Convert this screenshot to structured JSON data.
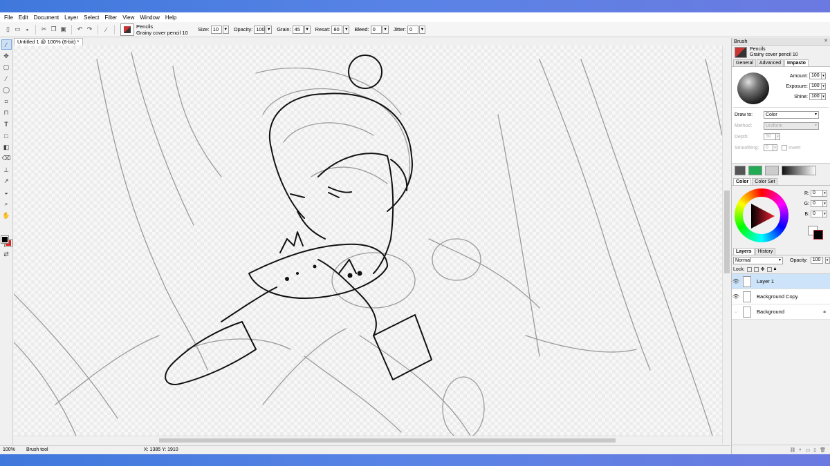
{
  "menu": [
    "File",
    "Edit",
    "Document",
    "Layer",
    "Select",
    "Filter",
    "View",
    "Window",
    "Help"
  ],
  "toolbar": {
    "brush_category": "Pencils",
    "brush_name": "Grainy cover pencil 10",
    "size_label": "Size:",
    "size_value": "10",
    "opacity_label": "Opacity:",
    "opacity_value": "100",
    "grain_label": "Grain:",
    "grain_value": "45",
    "resat_label": "Resat:",
    "resat_value": "80",
    "bleed_label": "Bleed:",
    "bleed_value": "0",
    "jitter_label": "Jitter:",
    "jitter_value": "0"
  },
  "document": {
    "tab_title": "Untitled 1 @ 100% (8-bit) *"
  },
  "status": {
    "zoom": "100%",
    "tool": "Brush tool",
    "coords": "X: 1385  Y: 1910"
  },
  "brush_panel": {
    "title": "Brush",
    "category": "Pencils",
    "name": "Grainy cover pencil 10",
    "tabs": [
      "General",
      "Advanced",
      "Impasto"
    ],
    "active_tab": "Impasto",
    "amount_label": "Amount:",
    "amount_value": "100",
    "exposure_label": "Exposure:",
    "exposure_value": "100",
    "shine_label": "Shine:",
    "shine_value": "100",
    "draw_to_label": "Draw to:",
    "draw_to_value": "Color",
    "method_label": "Method:",
    "method_value": "Uniform",
    "depth_label": "Depth:",
    "depth_value": "50",
    "smoothing_label": "Smoothing:",
    "smoothing_value": "0",
    "invert_label": "Invert"
  },
  "color_panel": {
    "tabs": [
      "Color",
      "Color Set"
    ],
    "active_tab": "Color",
    "r_label": "R:",
    "r_value": "0",
    "g_label": "G:",
    "g_value": "0",
    "b_label": "B:",
    "b_value": "0"
  },
  "layers_panel": {
    "tabs": [
      "Layers",
      "History"
    ],
    "active_tab": "Layers",
    "blend_mode": "Normal",
    "opacity_label": "Opacity:",
    "opacity_value": "100",
    "lock_label": "Lock:",
    "layers": [
      {
        "name": "Layer 1",
        "visible": true,
        "selected": true,
        "locked": false
      },
      {
        "name": "Background Copy",
        "visible": true,
        "selected": false,
        "locked": false
      },
      {
        "name": "Background",
        "visible": false,
        "selected": false,
        "locked": true
      }
    ]
  },
  "colors": {
    "accent": "#3f78dc",
    "foreground": "#000000",
    "background_swatch": "#dd2222",
    "selection": "#cde3fa"
  }
}
